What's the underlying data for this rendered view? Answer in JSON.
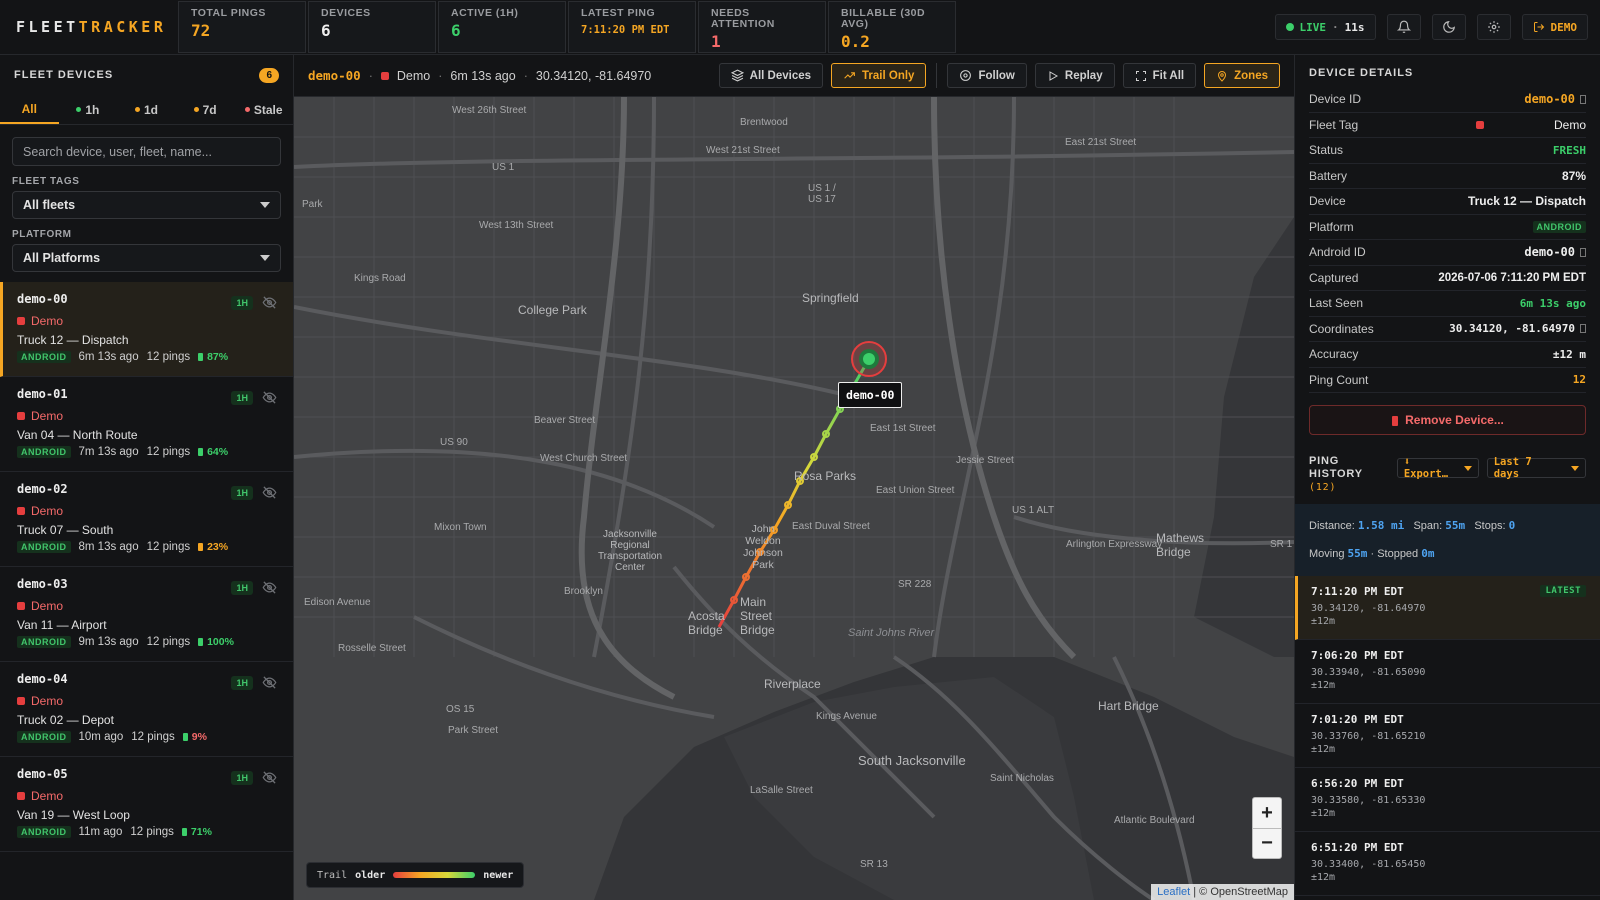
{
  "brand": {
    "left": "FLEET",
    "right": "TRACKER"
  },
  "stats": [
    {
      "label": "TOTAL PINGS",
      "value": "72",
      "color": "#f5a623"
    },
    {
      "label": "DEVICES",
      "value": "6",
      "color": "#eeeeee"
    },
    {
      "label": "ACTIVE (1H)",
      "value": "6",
      "color": "#3ccf6a"
    },
    {
      "label": "LATEST PING",
      "value": "7:11:20 PM EDT",
      "color": "#f5a623"
    },
    {
      "label": "NEEDS ATTENTION",
      "value": "1",
      "color": "#f56a6a"
    },
    {
      "label": "BILLABLE (30D AVG)",
      "value": "0.2",
      "color": "#f5a623"
    }
  ],
  "live": {
    "label": "LIVE",
    "countdown": "11s"
  },
  "demo_label": "DEMO",
  "sidebar": {
    "title": "FLEET DEVICES",
    "count": "6",
    "tabs": [
      {
        "label": "All",
        "dot": null
      },
      {
        "label": "1h",
        "dot": "#3ccf6a"
      },
      {
        "label": "1d",
        "dot": "#f5a623"
      },
      {
        "label": "7d",
        "dot": "#f5a623"
      },
      {
        "label": "Stale",
        "dot": "#f56a6a"
      }
    ],
    "search_placeholder": "Search device, user, fleet, name...",
    "fleet_tags_label": "FLEET TAGS",
    "fleet_tags_value": "All fleets",
    "platform_label": "PLATFORM",
    "platform_value": "All Platforms",
    "devices": [
      {
        "id": "demo-00",
        "fleet": "Demo",
        "label": "Truck 12 — Dispatch",
        "os": "ANDROID",
        "ago": "6m 13s ago",
        "pings": "12 pings",
        "battery": "87%",
        "battery_color": "#3ccf6a",
        "recency": "1H",
        "selected": true
      },
      {
        "id": "demo-01",
        "fleet": "Demo",
        "label": "Van 04 — North Route",
        "os": "ANDROID",
        "ago": "7m 13s ago",
        "pings": "12 pings",
        "battery": "64%",
        "battery_color": "#3ccf6a",
        "recency": "1H",
        "selected": false
      },
      {
        "id": "demo-02",
        "fleet": "Demo",
        "label": "Truck 07 — South",
        "os": "ANDROID",
        "ago": "8m 13s ago",
        "pings": "12 pings",
        "battery": "23%",
        "battery_color": "#f5a623",
        "recency": "1H",
        "selected": false
      },
      {
        "id": "demo-03",
        "fleet": "Demo",
        "label": "Van 11 — Airport",
        "os": "ANDROID",
        "ago": "9m 13s ago",
        "pings": "12 pings",
        "battery": "100%",
        "battery_color": "#3ccf6a",
        "recency": "1H",
        "selected": false
      },
      {
        "id": "demo-04",
        "fleet": "Demo",
        "label": "Truck 02 — Depot",
        "os": "ANDROID",
        "ago": "10m ago",
        "pings": "12 pings",
        "battery": "9%",
        "battery_color": "#f56a6a",
        "recency": "1H",
        "selected": false
      },
      {
        "id": "demo-05",
        "fleet": "Demo",
        "label": "Van 19 — West Loop",
        "os": "ANDROID",
        "ago": "11m ago",
        "pings": "12 pings",
        "battery": "71%",
        "battery_color": "#3ccf6a",
        "recency": "1H",
        "selected": false
      }
    ]
  },
  "center": {
    "device_id": "demo-00",
    "fleet": "Demo",
    "ago": "6m 13s ago",
    "coords": "30.34120, -81.64970",
    "buttons": {
      "all_devices": "All Devices",
      "trail_only": "Trail Only",
      "follow": "Follow",
      "replay": "Replay",
      "fit_all": "Fit All",
      "zones": "Zones"
    }
  },
  "map": {
    "marker_label": "demo-00",
    "legend": {
      "title": "Trail",
      "older": "older",
      "newer": "newer"
    },
    "attribution_link": "Leaflet",
    "attribution_rest": " | © OpenStreetMap",
    "zoom_in": "+",
    "zoom_out": "−",
    "labels": {
      "w26": "West 26th Street",
      "brentwood": "Brentwood",
      "w21": "West 21st Street",
      "e21": "East 21st Street",
      "us1": "US 1",
      "us1_17": "US 1 / US 17",
      "park": "Park",
      "w13": "West 13th Street",
      "kings": "Kings Road",
      "college": "College Park",
      "springfield": "Springfield",
      "beaver": "Beaver Street",
      "us90": "US 90",
      "e1st": "East 1st Street",
      "jessie": "Jessie Street",
      "wchurch": "West Church Street",
      "rosa": "Rosa Parks",
      "eunion": "East Union Street",
      "eduval": "East Duval Street",
      "us1alt": "US 1 ALT",
      "arlington": "Arlington Expressway",
      "mathews": "Mathews Bridge",
      "mixon": "Mixon Town",
      "jrtc": "Jacksonville Regional Transportation Center",
      "brooklyn": "Brooklyn",
      "sr228": "SR 228",
      "edison": "Edison Avenue",
      "acosta": "Acosta Bridge",
      "mainst": "Main Street Bridge",
      "stjohns": "Saint Johns River",
      "rosselle": "Rosselle Street",
      "riverplace": "Riverplace",
      "kings_ave": "Kings Avenue",
      "park_st": "Park Street",
      "hart": "Hart Bridge",
      "southjax": "South Jacksonville",
      "lasalle": "LaSalle Street",
      "stnicholas": "Saint Nicholas",
      "atlantic": "Atlantic Boulevard",
      "sr13": "SR 13",
      "os15": "OS 15",
      "jwj": "John Weldon Johnson Park",
      "sr1": "SR 1"
    }
  },
  "details": {
    "title": "DEVICE DETAILS",
    "rows": [
      {
        "k": "Device ID",
        "v": "demo-00",
        "color": "#f5a623",
        "mono": true
      },
      {
        "k": "Fleet Tag",
        "v": "Demo",
        "color": "#eeeeee",
        "mono": false
      },
      {
        "k": "Status",
        "v": "FRESH",
        "color": "#3ccf6a",
        "mono": true
      },
      {
        "k": "Battery",
        "v": "87%",
        "color": "#eeeeee",
        "mono": false
      },
      {
        "k": "Device",
        "v": "Truck 12 — Dispatch",
        "color": "#eeeeee",
        "mono": false
      },
      {
        "k": "Platform",
        "v": "ANDROID",
        "color": "#41c56b",
        "mono": false
      },
      {
        "k": "Android ID",
        "v": "demo-00",
        "color": "#eeeeee",
        "mono": true
      },
      {
        "k": "Captured",
        "v": "2026-07-06 7:11:20 PM EDT",
        "color": "#eeeeee",
        "mono": false
      },
      {
        "k": "Last Seen",
        "v": "6m 13s ago",
        "color": "#3ccf6a",
        "mono": true
      },
      {
        "k": "Coordinates",
        "v": "30.34120, -81.64970",
        "color": "#eeeeee",
        "mono": true
      },
      {
        "k": "Accuracy",
        "v": "±12 m",
        "color": "#eeeeee",
        "mono": true
      },
      {
        "k": "Ping Count",
        "v": "12",
        "color": "#f5a623",
        "mono": true
      }
    ],
    "remove_label": "Remove Device..."
  },
  "ping_history": {
    "title": "PING HISTORY",
    "count": "(12)",
    "export_label": "⬇ Export…",
    "range_label": "Last 7 days",
    "summary": {
      "distance_label": "Distance:",
      "distance": "1.58 mi",
      "span_label": "Span:",
      "span": "55m",
      "stops_label": "Stops:",
      "stops": "0",
      "moving_label": "Moving",
      "moving": "55m",
      "stopped_label": "· Stopped",
      "stopped": "0m"
    },
    "latest_label": "LATEST",
    "pings": [
      {
        "time": "7:11:20 PM EDT",
        "coords": "30.34120, -81.64970",
        "acc": "±12m"
      },
      {
        "time": "7:06:20 PM EDT",
        "coords": "30.33940, -81.65090",
        "acc": "±12m"
      },
      {
        "time": "7:01:20 PM EDT",
        "coords": "30.33760, -81.65210",
        "acc": "±12m"
      },
      {
        "time": "6:56:20 PM EDT",
        "coords": "30.33580, -81.65330",
        "acc": "±12m"
      },
      {
        "time": "6:51:20 PM EDT",
        "coords": "30.33400, -81.65450",
        "acc": "±12m"
      }
    ]
  }
}
